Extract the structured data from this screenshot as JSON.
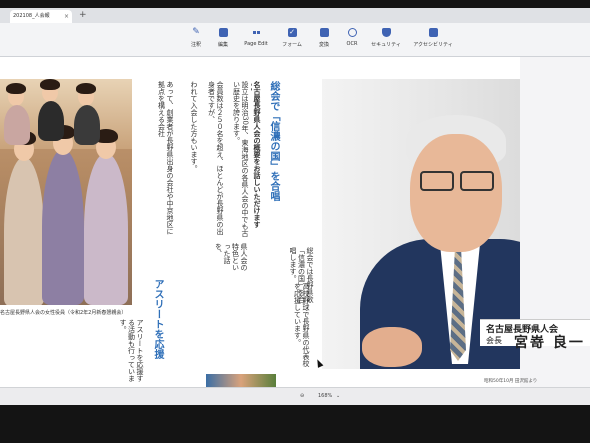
{
  "tab": {
    "title": "202108_人会報",
    "close": "×",
    "new": "+"
  },
  "toolbar": {
    "items": [
      {
        "label": "注釈"
      },
      {
        "label": "編集"
      },
      {
        "label": "Page Edit"
      },
      {
        "label": "フォーム"
      },
      {
        "label": "変換"
      },
      {
        "label": "OCR"
      },
      {
        "label": "セキュリティ"
      },
      {
        "label": "アクセシビリティ"
      }
    ]
  },
  "article": {
    "headline1": "総会で「信濃の国」を合唱",
    "headline2": "アスリートを応援",
    "photo_caption": "名古屋長野県人会の女性役員（令和2年2月新春懇親会）",
    "col1": "名古屋長野県人会の概要をお話しいただけますか？",
    "col2": "設立は明治30年、東海地区の各県人会の中でも古い歴史を誇ります。",
    "col3": "会員数は２５０名を超え、ほとんどが長野県の出身者ですが、",
    "col4": "われて入会した方もいます。",
    "col5": "あって、創業者が長野県出身の会社や中京地区に拠点を構える会社",
    "col6": "総会では長野県歌「信濃の国」を合唱します。",
    "col7": "県人会の特色といった話を、",
    "col8": "高校野球で長野県の代表校を応援しています。",
    "col9": "アスリートを応援する活動も行っています。"
  },
  "nameplate": {
    "org": "名古屋長野県人会",
    "role": "会長",
    "name": "宮嵜 良一",
    "date": "昭和50年10月 田沢館より"
  },
  "status": {
    "zoom_value": "168%"
  }
}
